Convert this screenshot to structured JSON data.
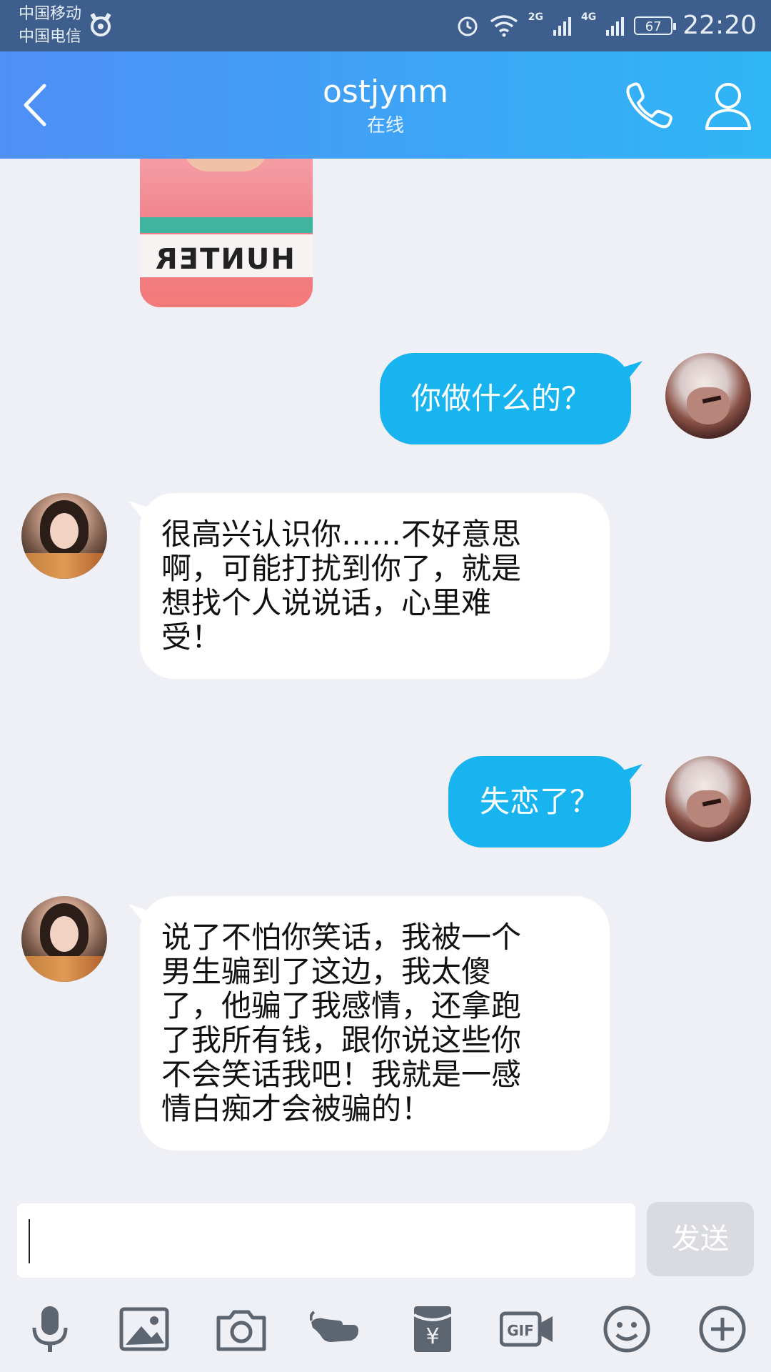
{
  "status_bar": {
    "carrier_1": "中国移动",
    "carrier_2": "中国电信",
    "network_1": "2G",
    "network_2": "4G",
    "battery": "67",
    "time": "22:20"
  },
  "header": {
    "title": "ostjynm",
    "subtitle": "在线",
    "back_icon": "chevron-left-icon",
    "call_icon": "phone-icon",
    "profile_icon": "user-icon"
  },
  "messages": [
    {
      "sender": "me",
      "text": "你做什么的？"
    },
    {
      "sender": "her",
      "lines": [
        "很高兴认识你……不好意思",
        "啊，可能打扰到你了，就是",
        "想找个人说说话，心里难",
        "受！"
      ]
    },
    {
      "sender": "me",
      "text": "失恋了？"
    },
    {
      "sender": "her",
      "lines": [
        "说了不怕你笑话，我被一个",
        "男生骗到了这边，我太傻",
        "了，他骗了我感情，还拿跑",
        "了我所有钱，跟你说这些你",
        "不会笑话我吧！我就是一感",
        "情白痴才会被骗的！"
      ]
    }
  ],
  "photo_message": {
    "print_text": "HUNTER"
  },
  "composer": {
    "placeholder": "",
    "send_label": "发送"
  },
  "toolbar": {
    "icons": [
      "microphone-icon",
      "image-icon",
      "camera-icon",
      "poke-icon",
      "red-packet-icon",
      "gif-icon",
      "emoji-icon",
      "plus-icon"
    ],
    "gif_label": "GIF",
    "yuan_label": "¥"
  },
  "colors": {
    "header_start": "#4f8ff6",
    "header_end": "#2fb6f6",
    "bubble_out": "#18b4f0",
    "background": "#eef0f5"
  }
}
